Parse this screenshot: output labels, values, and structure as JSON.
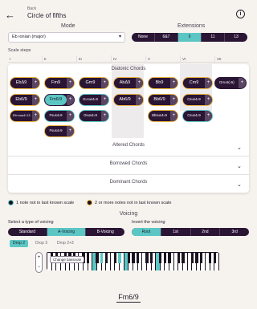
{
  "header": {
    "back_label": "Back",
    "title": "Circle of fifths",
    "back_icon": "arrow-left",
    "info_icon": "info"
  },
  "mode": {
    "label": "Mode",
    "selected": "Eb ionian (major)"
  },
  "extensions": {
    "label": "Extensions",
    "options": [
      "None",
      "6&7",
      "9",
      "11",
      "13"
    ],
    "active": "9"
  },
  "scale_steps": {
    "label": "Scale steps",
    "steps": [
      "I",
      "II",
      "III",
      "IV",
      "V",
      "VI",
      "VII"
    ]
  },
  "diatonic": {
    "label": "Diatonic Chords",
    "row1": [
      "EbΔ9",
      "Fm9",
      "Gm9",
      "AbΔ9",
      "Bb9",
      "Cm9",
      "Dm♭9(♭5)"
    ],
    "row2": [
      "Eb6/9",
      "Fm6/9",
      "G♭sus4♭9",
      "Ab6/9",
      "Bb6/9",
      "Csus4♭9"
    ],
    "row3": [
      "Eb♭sus4♭13",
      "Fsus4♭9",
      "Gsus4♭9",
      "Bbsus4♭9",
      "Csus4♭9"
    ],
    "row4": [
      "Fsus4♭9"
    ]
  },
  "collapsed_groups": [
    "Altered Chords",
    "Borrowed Chords",
    "Dominant Chords"
  ],
  "legend": {
    "one_note": "1 note not in last known scale",
    "two_notes": "2 or more notes not in last known scale"
  },
  "voicing": {
    "label": "Voicing",
    "type_label": "Select a type of voicing",
    "types": [
      "Standard",
      "A-Voicing",
      "B-Voicing"
    ],
    "active_type": "A-Voicing",
    "invert_label": "Invert the voicing",
    "inversions": [
      "Root",
      "1st",
      "2nd",
      "3rd"
    ],
    "active_inversion": "Root",
    "drops": [
      "Drop 2",
      "Drop 3",
      "Drop 2+3"
    ],
    "active_drop": "Drop 2"
  },
  "piano": {
    "change_bass_label": "Change bassnote",
    "octave_up": "+",
    "octave_down": "−"
  },
  "chord_display": "Fm6/9",
  "colors": {
    "accent": "#5cc6c4",
    "dark": "#2b1535",
    "warning": "#e8b33c",
    "background": "#f6f3ef"
  }
}
